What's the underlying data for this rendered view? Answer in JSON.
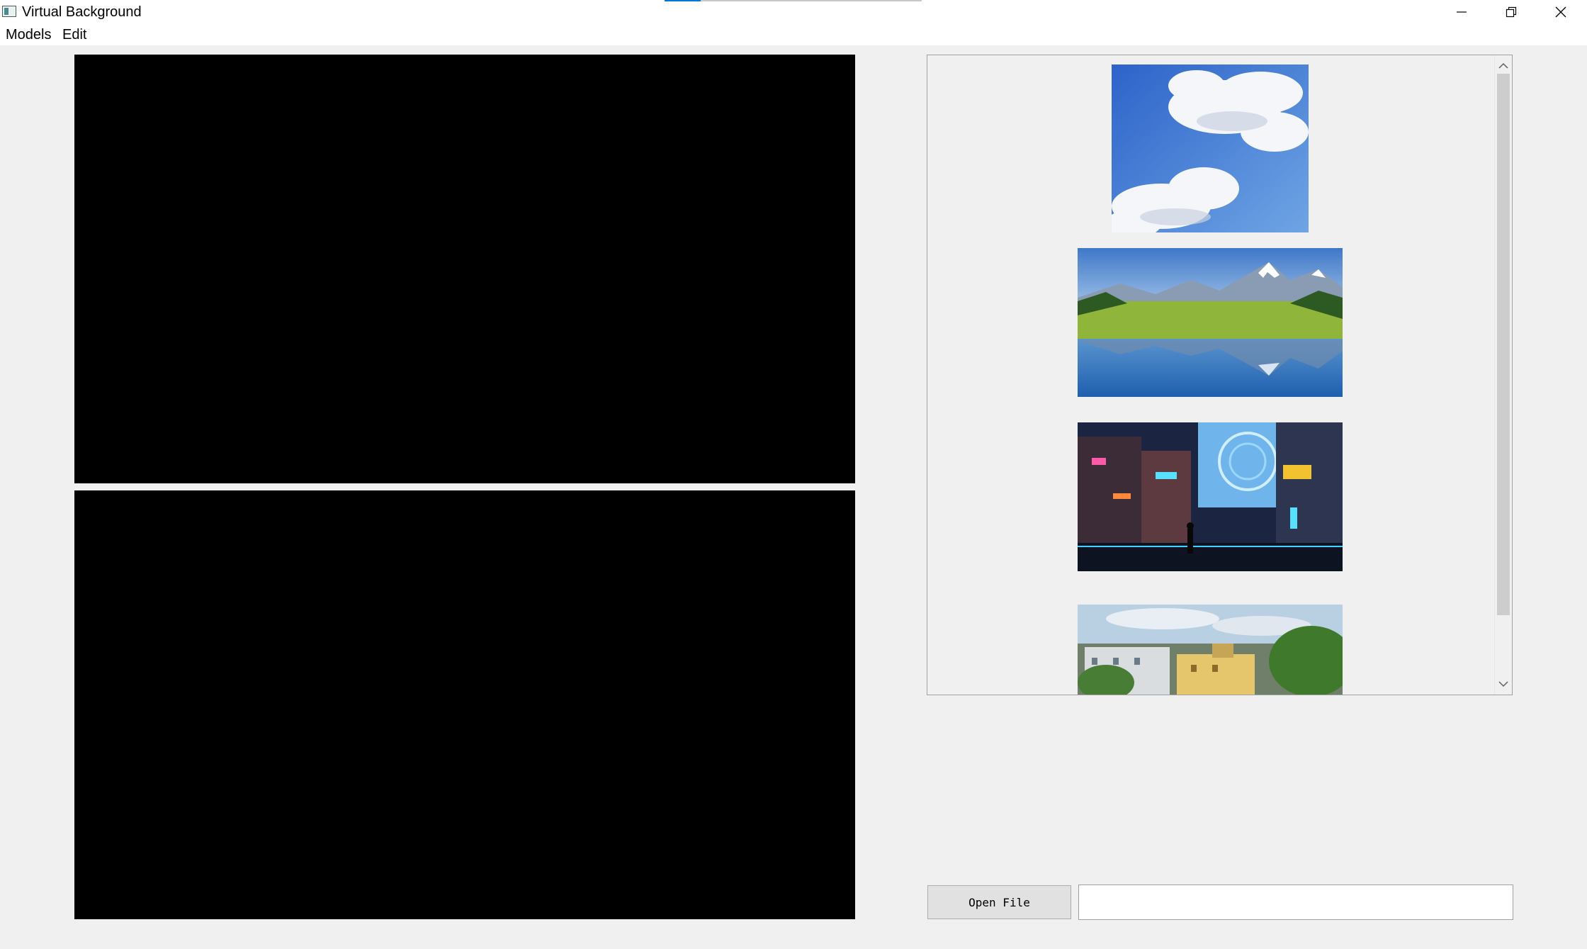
{
  "window": {
    "title": "Virtual Background",
    "progress": 0.14,
    "accent_color": "#0078d7",
    "controls": {
      "minimize_icon": "minimize-icon",
      "maximize_icon": "restore-icon",
      "close_icon": "close-icon"
    }
  },
  "menu": {
    "items": [
      {
        "label": "Models"
      },
      {
        "label": "Edit"
      }
    ]
  },
  "video_panes": [
    {
      "name": "input-video-view",
      "color": "#000000"
    },
    {
      "name": "output-video-view",
      "color": "#000000"
    }
  ],
  "gallery": {
    "items": [
      {
        "name": "background-thumbnail-sky"
      },
      {
        "name": "background-thumbnail-mountain-lake"
      },
      {
        "name": "background-thumbnail-cyber-city"
      },
      {
        "name": "background-thumbnail-town"
      }
    ],
    "scroll_up_icon": "chevron-up-icon",
    "scroll_down_icon": "chevron-down-icon"
  },
  "controls": {
    "open_file_label": "Open File",
    "file_path_value": ""
  }
}
